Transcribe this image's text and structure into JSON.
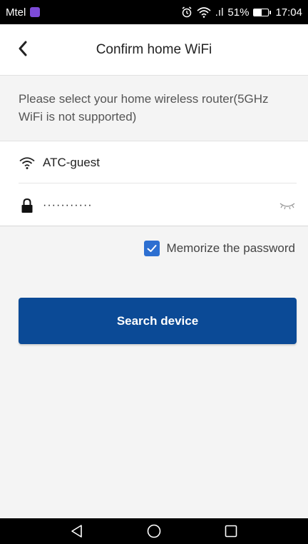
{
  "status_bar": {
    "carrier": "Mtel",
    "signal_text": ".ıl",
    "battery_percent_text": "51%",
    "battery_level": 0.51,
    "time": "17:04",
    "icons": [
      "viber-icon",
      "alarm-icon",
      "wifi-icon",
      "signal-icon",
      "battery-icon"
    ]
  },
  "header": {
    "back_icon": "chevron-left-icon",
    "title": "Confirm home WiFi"
  },
  "hint": "Please select your home wireless router(5GHz WiFi is not supported)",
  "wifi": {
    "ssid_icon": "wifi-icon",
    "ssid": "ATC-guest",
    "password_icon": "lock-icon",
    "password_masked": "···········",
    "toggle_icon": "eye-closed-icon"
  },
  "memorize": {
    "checked": true,
    "label": "Memorize the password"
  },
  "search_button": {
    "label": "Search device"
  },
  "colors": {
    "primary": "#0b4a96",
    "checkbox": "#2d6fd1",
    "background": "#f4f4f4"
  },
  "nav_bar": {
    "icons": [
      "back-triangle-icon",
      "home-circle-icon",
      "recents-square-icon"
    ]
  }
}
